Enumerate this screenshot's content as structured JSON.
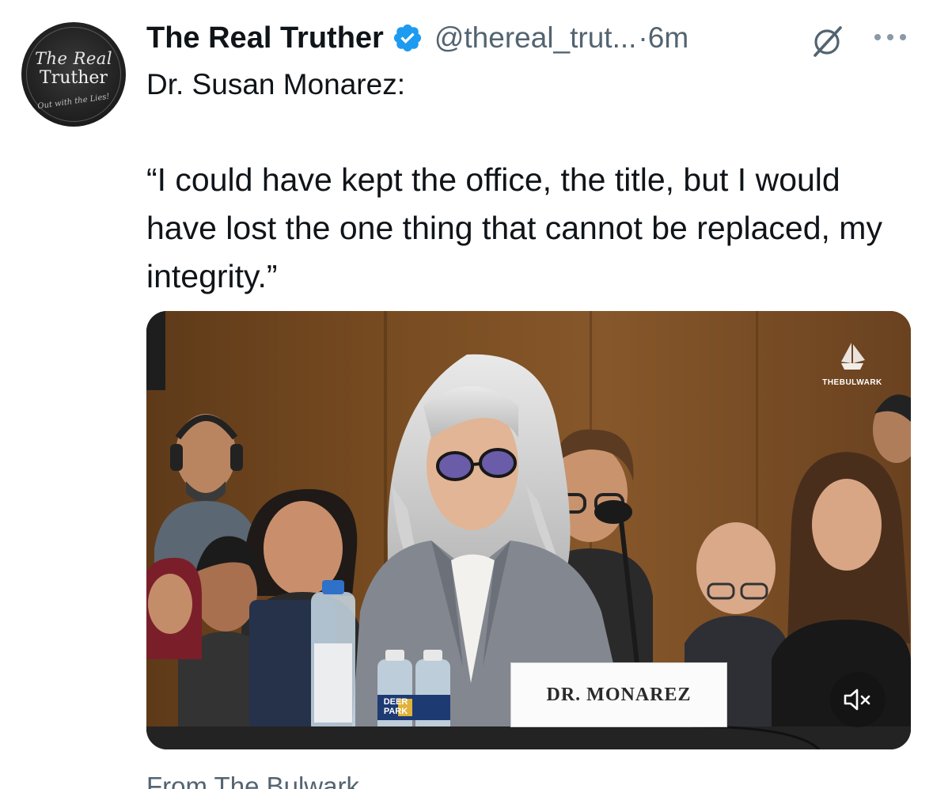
{
  "tweet": {
    "avatar_text": {
      "line1": "The Real",
      "line2": "Truther",
      "line3": "Out with the Lies!"
    },
    "display_name": "The Real Truther",
    "handle": "@thereal_trut...",
    "separator": "·",
    "time": "6m",
    "intro": "Dr. Susan Monarez:",
    "quote": "“I could have kept the office, the title, but I would have lost the one thing that cannot be replaced, my integrity.”",
    "media": {
      "watermark_text": "THEBULWARK",
      "nameplate": "DR. MONAREZ",
      "bottle_label": "DEER PARK"
    },
    "source": "From The Bulwark"
  },
  "icons": {
    "verified": "verified-badge-icon",
    "grok": "grok-icon",
    "more": "more-options-icon",
    "mute": "muted-speaker-icon"
  },
  "colors": {
    "text_primary": "#0f1419",
    "text_secondary": "#536471",
    "verified_blue": "#1d9bf0"
  }
}
